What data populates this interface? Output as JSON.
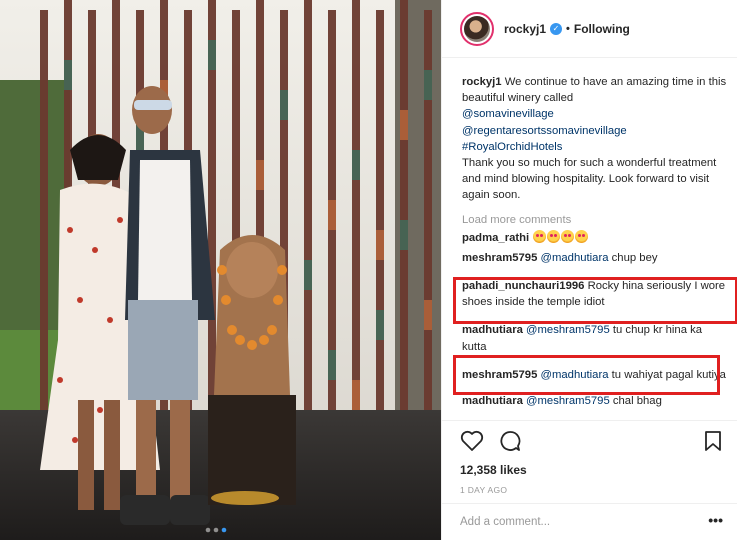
{
  "post": {
    "username": "rockyj1",
    "follow_status": "Following",
    "dot": "•",
    "caption": {
      "author": "rockyj1",
      "text1": "We continue to have an amazing time in this beautiful winery called",
      "mention1": "@somavinevillage",
      "mention2": "@regentaresortssomavinevillage",
      "mention3": "#RoyalOrchidHotels",
      "text2": "Thank you so much for such a wonderful treatment and mind blowing hospitality. Look forward to visit again soon."
    },
    "load_more": "Load more comments",
    "comments": [
      {
        "user": "padma_rathi",
        "mention": "",
        "text": ""
      },
      {
        "user": "meshram5795",
        "mention": "@madhutiara",
        "text": "chup bey"
      },
      {
        "user": "pahadi_nunchauri1996",
        "mention": "",
        "text": "Rocky hina seriously I wore shoes inside the temple idiot"
      },
      {
        "user": "madhutiara",
        "mention": "@meshram5795",
        "text": "tu chup kr hina ka kutta"
      },
      {
        "user": "meshram5795",
        "mention": "@madhutiara",
        "text": "tu wahiyat pagal kutiya"
      },
      {
        "user": "madhutiara",
        "mention": "@meshram5795",
        "text": "chal bhag"
      }
    ],
    "likes": "12,358 likes",
    "time": "1 DAY AGO",
    "add_comment_placeholder": "Add a comment...",
    "more_options": "•••",
    "carousel_position": "3 of 3"
  },
  "colors": {
    "highlight": "#e02020",
    "mention": "#003569",
    "verified": "#3897f0"
  },
  "icons": [
    "heart-icon",
    "comment-icon",
    "bookmark-icon",
    "verified-icon"
  ]
}
